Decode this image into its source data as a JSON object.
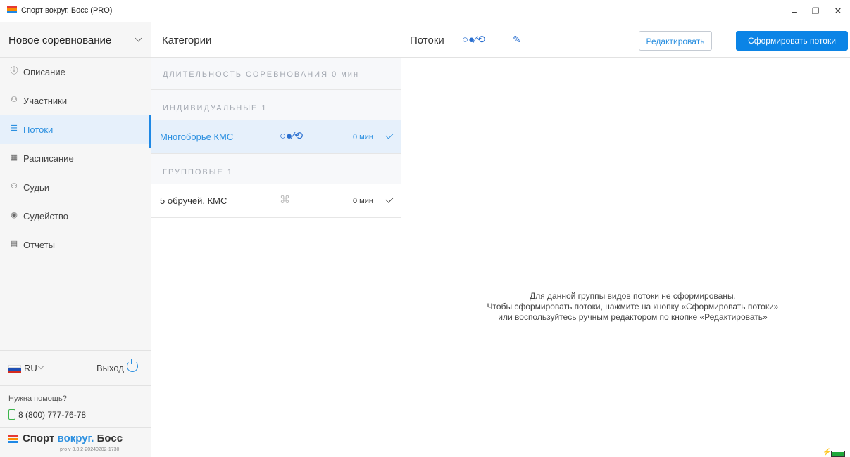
{
  "window": {
    "title": "Спорт вокруг. Босс (PRO)",
    "minimize": "–",
    "restore": "❐",
    "close": "✕"
  },
  "sidebar": {
    "competition": "Новое соревнование",
    "items": [
      {
        "label": "Описание",
        "icon": "ⓘ",
        "icon_name": "info-icon"
      },
      {
        "label": "Участники",
        "icon": "⚇",
        "icon_name": "participants-icon"
      },
      {
        "label": "Потоки",
        "icon": "☰",
        "icon_name": "list-icon",
        "active": true
      },
      {
        "label": "Расписание",
        "icon": "▦",
        "icon_name": "calendar-icon"
      },
      {
        "label": "Судьи",
        "icon": "⚇",
        "icon_name": "judges-icon"
      },
      {
        "label": "Судейство",
        "icon": "◉",
        "icon_name": "play-icon"
      },
      {
        "label": "Отчеты",
        "icon": "▤",
        "icon_name": "report-icon"
      }
    ],
    "language": "RU",
    "exit": "Выход",
    "help_label": "Нужна помощь?",
    "phone": "8 (800) 777-76-78",
    "brand_1": "Спорт ",
    "brand_2": "вокруг.",
    "brand_3": " Босс",
    "version": "pro v 3.3.2-20240202-1730"
  },
  "categories": {
    "title": "Категории",
    "duration": "ДЛИТЕЛЬНОСТЬ СОРЕВНОВАНИЯ 0 мин",
    "individual_title": "ИНДИВИДУАЛЬНЫЕ 1",
    "group_title": "ГРУППОВЫЕ 1",
    "individual": [
      {
        "name": "Многоборье КМС",
        "apparatus": "○●⁄⟲",
        "duration": "0 мин"
      }
    ],
    "group": [
      {
        "name": "5 обручей. КМС",
        "apparatus": "⌘",
        "duration": "0 мин"
      }
    ]
  },
  "main": {
    "title": "Потоки",
    "apparatus": "○●⁄⟲",
    "edit_button": "Редактировать",
    "generate_button": "Сформировать потоки",
    "empty_line1": "Для данной группы видов потоки не сформированы.",
    "empty_line2": "Чтобы сформировать потоки, нажмите на кнопку «Сформировать потоки»",
    "empty_line3": "или воспользуйтесь ручным редактором по кнопке «Редактировать»"
  },
  "colors": {
    "accent": "#0b84e6",
    "active_bg": "#e6f0fb",
    "phone_green": "#3bb54a"
  }
}
